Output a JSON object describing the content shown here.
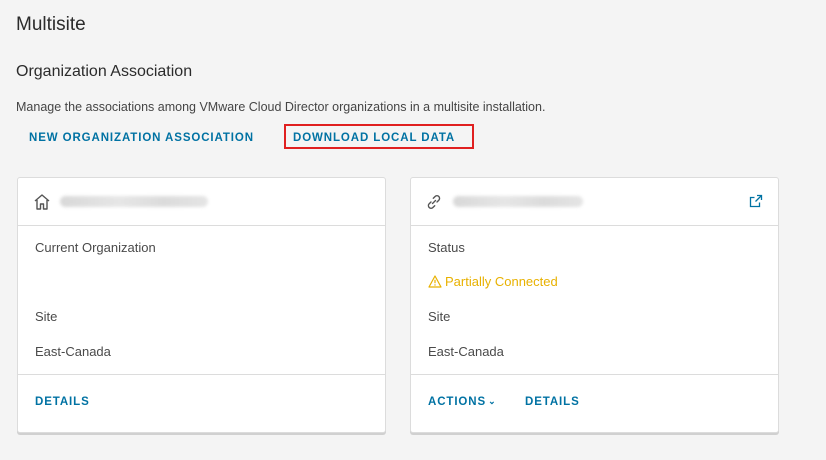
{
  "page": {
    "title": "Multisite"
  },
  "section": {
    "title": "Organization Association",
    "description": "Manage the associations among VMware Cloud Director organizations in a multisite installation."
  },
  "actions": {
    "new_association": "NEW ORGANIZATION ASSOCIATION",
    "download_local_data": "DOWNLOAD LOCAL DATA"
  },
  "colors": {
    "accent": "#0072a3",
    "warning": "#e8b100",
    "highlight": "#e02020"
  },
  "cards": [
    {
      "icon": "home-icon",
      "field1_label": "Current Organization",
      "site_label": "Site",
      "site_value": "East-Canada",
      "details": "DETAILS"
    },
    {
      "icon": "link-icon",
      "status_label": "Status",
      "status_value": "Partially Connected",
      "status_icon": "warning-icon",
      "site_label": "Site",
      "site_value": "East-Canada",
      "actions": "ACTIONS",
      "details": "DETAILS",
      "external_icon": "external-link-icon"
    }
  ]
}
